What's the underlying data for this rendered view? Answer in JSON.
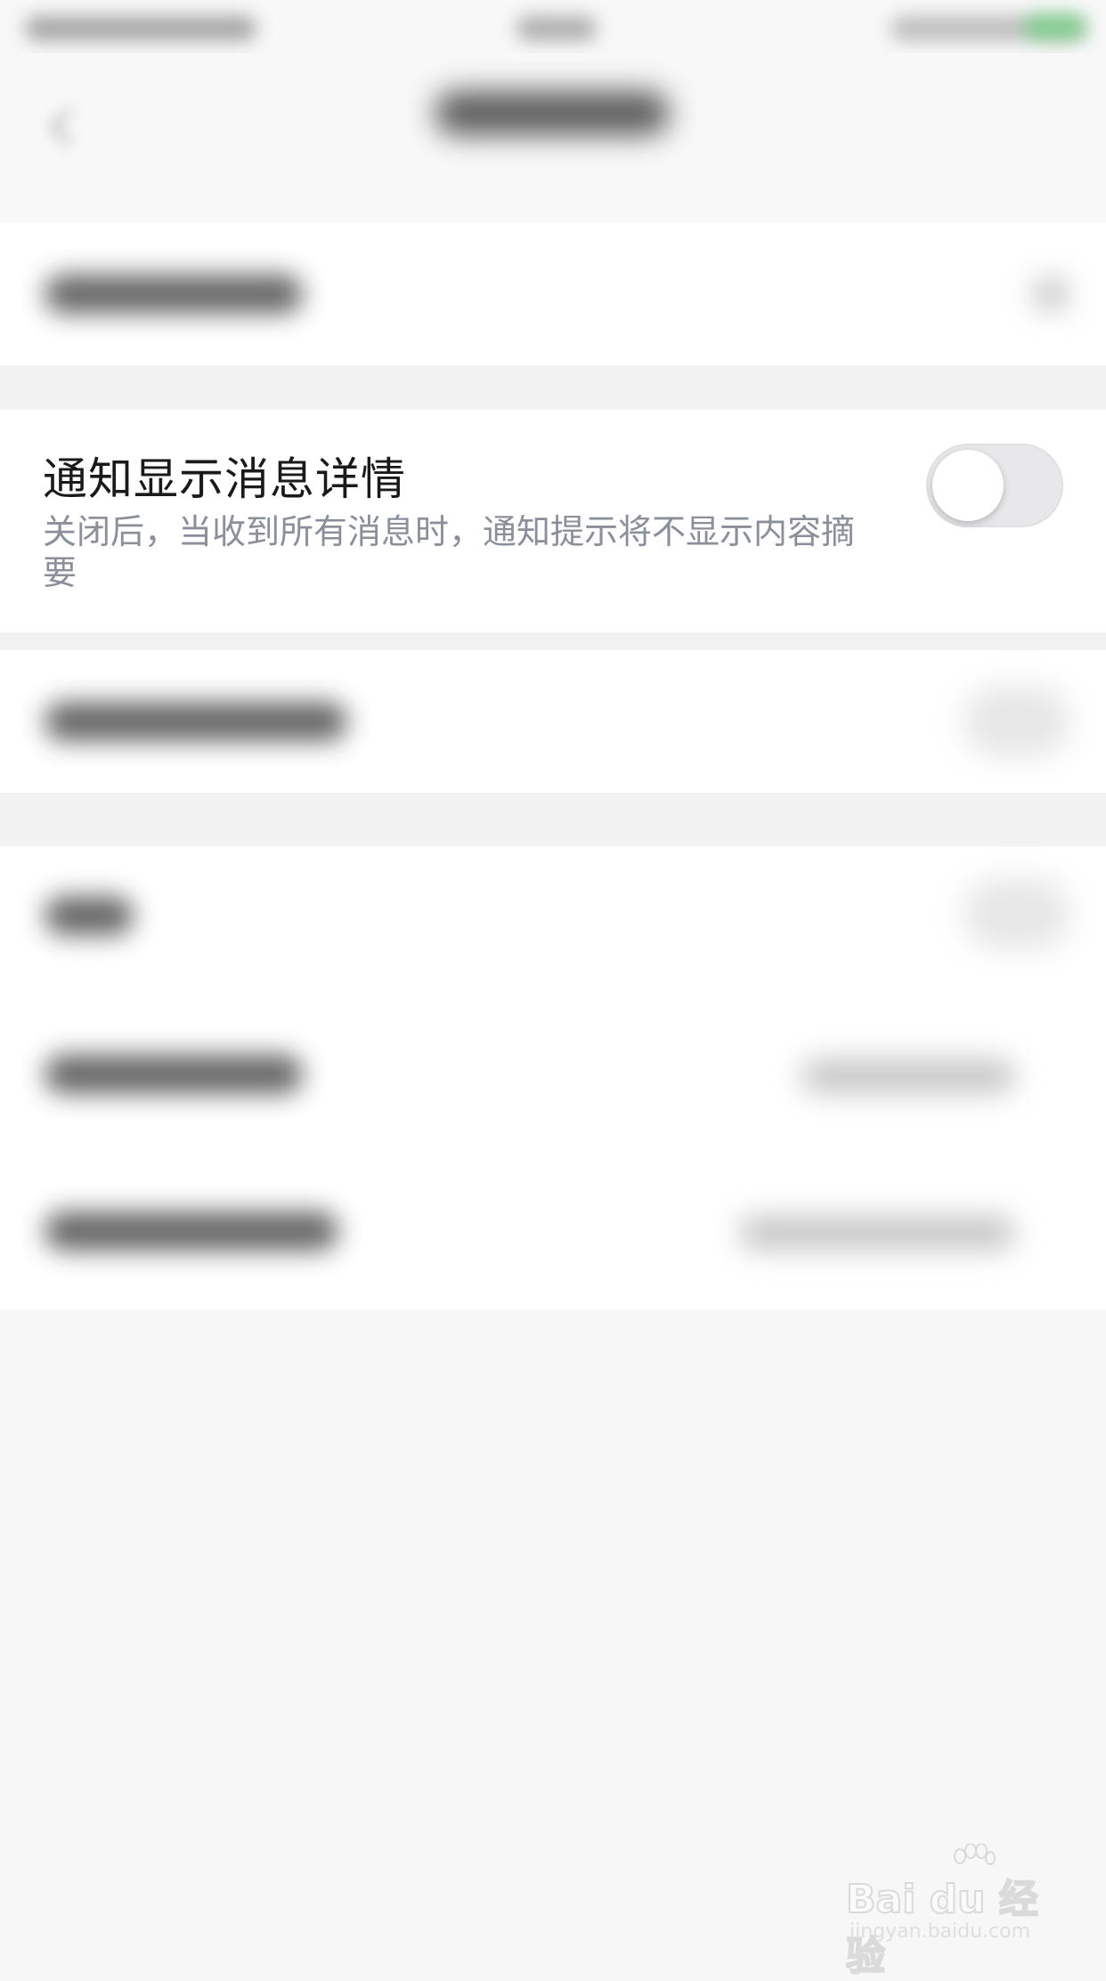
{
  "notification_detail": {
    "title": "通知显示消息详情",
    "description": "关闭后，当收到所有消息时，通知提示将不显示内容摘要",
    "toggle_state": "off"
  },
  "watermark": {
    "logo_text": "Bai du 经验",
    "url": "jingyan.baidu.com"
  },
  "colors": {
    "background": "#f7f7f7",
    "card": "#ffffff",
    "title_text": "#1a1a1a",
    "description_text": "#8a8f99",
    "toggle_off_track": "#e8e8ea"
  }
}
